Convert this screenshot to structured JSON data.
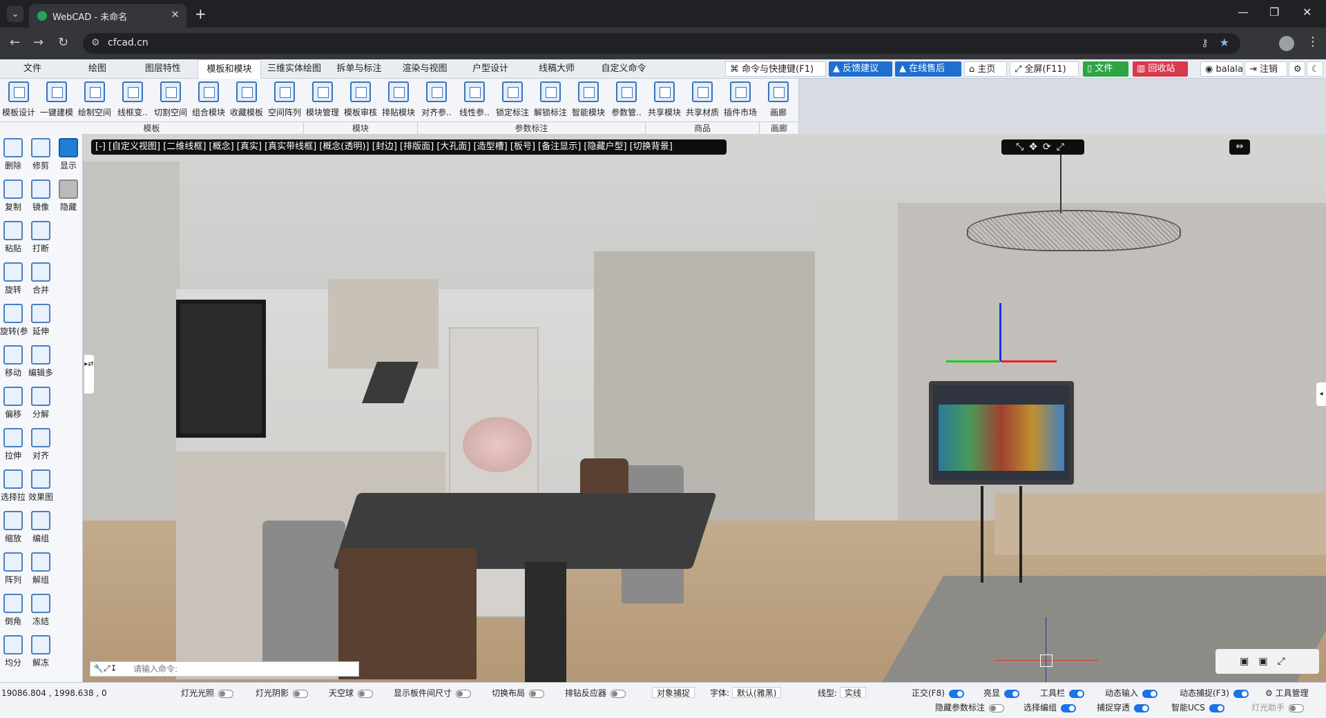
{
  "browser": {
    "tab_title": "WebCAD - 未命名",
    "url": "cfcad.cn"
  },
  "menu": {
    "tabs": [
      "文件",
      "绘图",
      "图层特性",
      "模板和模块",
      "三维实体绘图",
      "拆单与标注",
      "渲染与视图",
      "户型设计",
      "线稿大师",
      "自定义命令"
    ],
    "active_tab": "模板和模块",
    "right": {
      "shortcuts": "命令与快捷键(F1)",
      "feedback": "反馈建议",
      "support": "在线售后",
      "home": "主页",
      "fullscreen": "全屏(F11)",
      "file": "文件",
      "recycle": "回收站",
      "user": "balala",
      "logout": "注销"
    }
  },
  "ribbon": {
    "items": [
      "模板设计",
      "一键建模",
      "绘制空间",
      "线框变..",
      "切割空间",
      "组合模块",
      "收藏模板",
      "空间阵列",
      "模块管理",
      "模板审核",
      "排贴模块",
      "对齐参..",
      "线性参..",
      "锁定标注",
      "解锁标注",
      "智能模块",
      "参数管..",
      "共享模块",
      "共享材质",
      "插件市场",
      "画廊"
    ],
    "groups": [
      "模板",
      "模块",
      "参数标注",
      "商品",
      "画廊"
    ]
  },
  "left_tools": [
    {
      "label": "删除",
      "icon": "delete-icon"
    },
    {
      "label": "修剪",
      "icon": "trim-icon"
    },
    {
      "label": "显示",
      "icon": "show-icon"
    },
    {
      "label": "复制",
      "icon": "copy-icon"
    },
    {
      "label": "镜像",
      "icon": "mirror-icon"
    },
    {
      "label": "隐藏",
      "icon": "hide-icon"
    },
    {
      "label": "粘贴",
      "icon": "paste-icon"
    },
    {
      "label": "打断",
      "icon": "break-icon"
    },
    {
      "label": "旋转",
      "icon": "rotate-icon"
    },
    {
      "label": "合并",
      "icon": "merge-icon"
    },
    {
      "label": "旋转(参",
      "icon": "rotate-param-icon"
    },
    {
      "label": "延伸",
      "icon": "extend-icon"
    },
    {
      "label": "移动",
      "icon": "move-icon"
    },
    {
      "label": "编辑多",
      "icon": "edit-multi-icon"
    },
    {
      "label": "偏移",
      "icon": "offset-icon"
    },
    {
      "label": "分解",
      "icon": "explode-icon"
    },
    {
      "label": "拉伸",
      "icon": "stretch-icon"
    },
    {
      "label": "对齐",
      "icon": "align-icon"
    },
    {
      "label": "选择拉",
      "icon": "select-stretch-icon"
    },
    {
      "label": "效果图",
      "icon": "render-icon"
    },
    {
      "label": "缩放",
      "icon": "scale-icon"
    },
    {
      "label": "编组",
      "icon": "group-icon"
    },
    {
      "label": "阵列",
      "icon": "array-icon"
    },
    {
      "label": "解组",
      "icon": "ungroup-icon"
    },
    {
      "label": "倒角",
      "icon": "chamfer-icon"
    },
    {
      "label": "冻结",
      "icon": "freeze-icon"
    },
    {
      "label": "均分",
      "icon": "divide-icon"
    },
    {
      "label": "解冻",
      "icon": "unfreeze-icon"
    }
  ],
  "viewport": {
    "modes": "[-] [自定义视图] [二维线框] [概念] [真实] [真实带线框] [概念(透明)] [封边] [排版面] [大孔面] [造型槽] [板号] [备注显示] [隐藏户型] [切换背景]",
    "command_placeholder": "请输入命令:"
  },
  "status": {
    "coords": "19086.804 , 1998.638 , 0",
    "row1": [
      {
        "label": "灯光光照",
        "on": false
      },
      {
        "label": "灯光阴影",
        "on": false
      },
      {
        "label": "天空球",
        "on": false
      },
      {
        "label": "显示板件间尺寸",
        "on": false
      },
      {
        "label": "切换布局",
        "on": false
      },
      {
        "label": "排钻反应器",
        "on": false
      }
    ],
    "snap_button": "对象捕捉",
    "font_label": "字体:",
    "font_value": "默认(雅黑)",
    "linetype_label": "线型:",
    "linetype_value": "实线",
    "row1_right": [
      {
        "label": "正交(F8)",
        "on": true
      },
      {
        "label": "亮显",
        "on": true
      },
      {
        "label": "工具栏",
        "on": true
      },
      {
        "label": "动态输入",
        "on": true
      },
      {
        "label": "动态捕捉(F3)",
        "on": true
      }
    ],
    "tool_manage": "工具管理",
    "row2": [
      {
        "label": "隐藏参数标注",
        "on": false
      },
      {
        "label": "选择编组",
        "on": true
      },
      {
        "label": "捕捉穿透",
        "on": true
      },
      {
        "label": "智能UCS",
        "on": true
      },
      {
        "label": "灯光助手",
        "on": false
      }
    ]
  },
  "colors": {
    "accent": "#1f6fd1",
    "green": "#2fa443",
    "red": "#d8394c"
  }
}
